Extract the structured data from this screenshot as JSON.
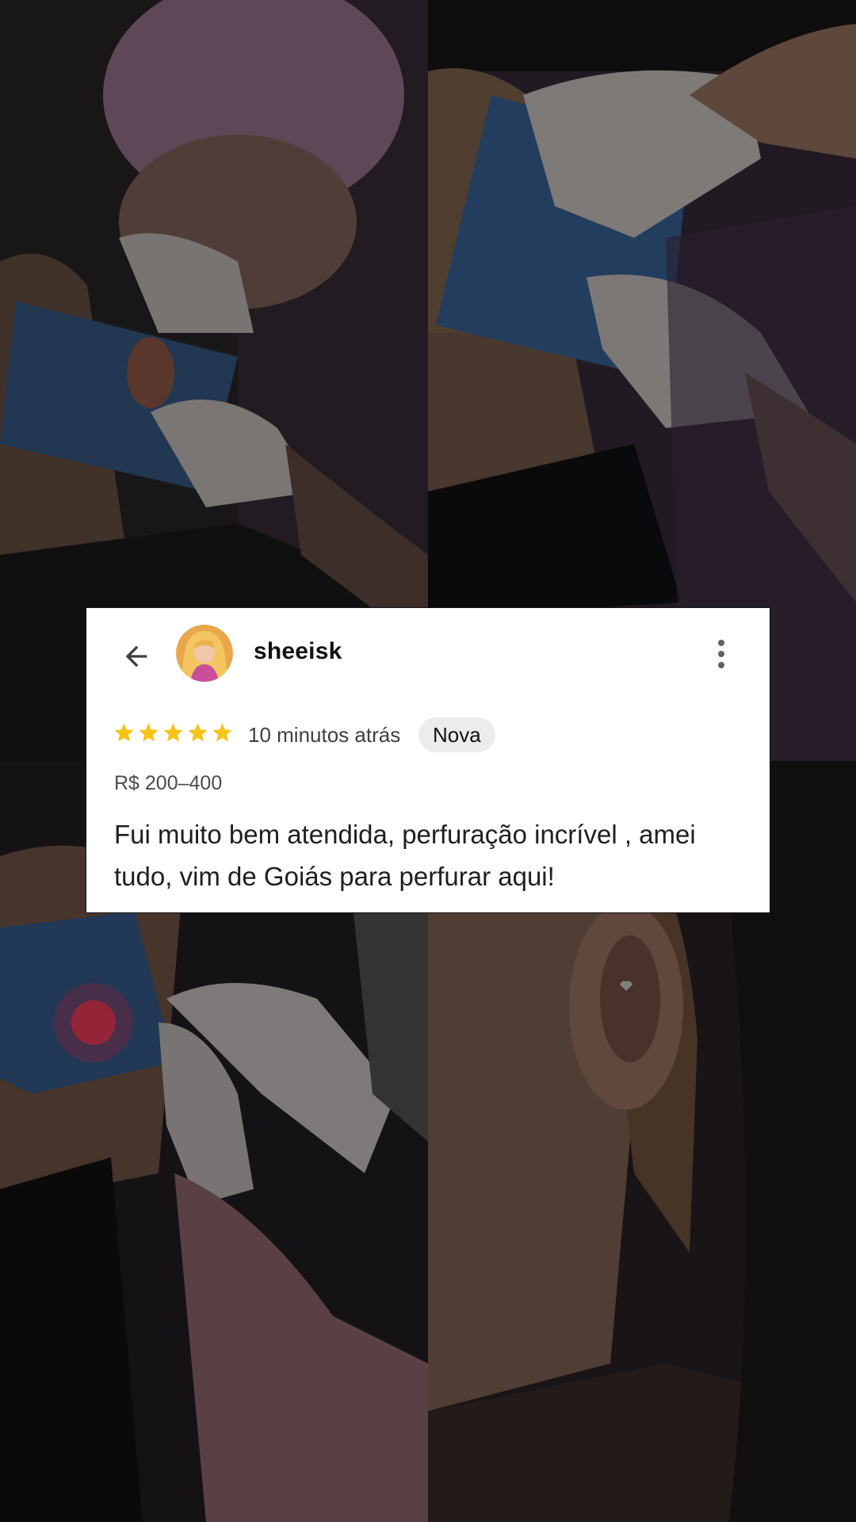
{
  "review": {
    "username": "sheeisk",
    "rating": 5,
    "rating_max": 5,
    "time": "10 minutos atrás",
    "badge": "Nova",
    "price": "R$ 200–400",
    "text": "Fui muito bem atendida, perfuração incrível , amei tudo, vim de Goiás para perfurar aqui!"
  },
  "icons": {
    "back": "arrow-left-icon",
    "more": "more-vertical-icon",
    "star": "star-icon"
  },
  "colors": {
    "star": "#f4c518",
    "card_bg": "#ffffff",
    "badge_bg": "#ececec"
  }
}
